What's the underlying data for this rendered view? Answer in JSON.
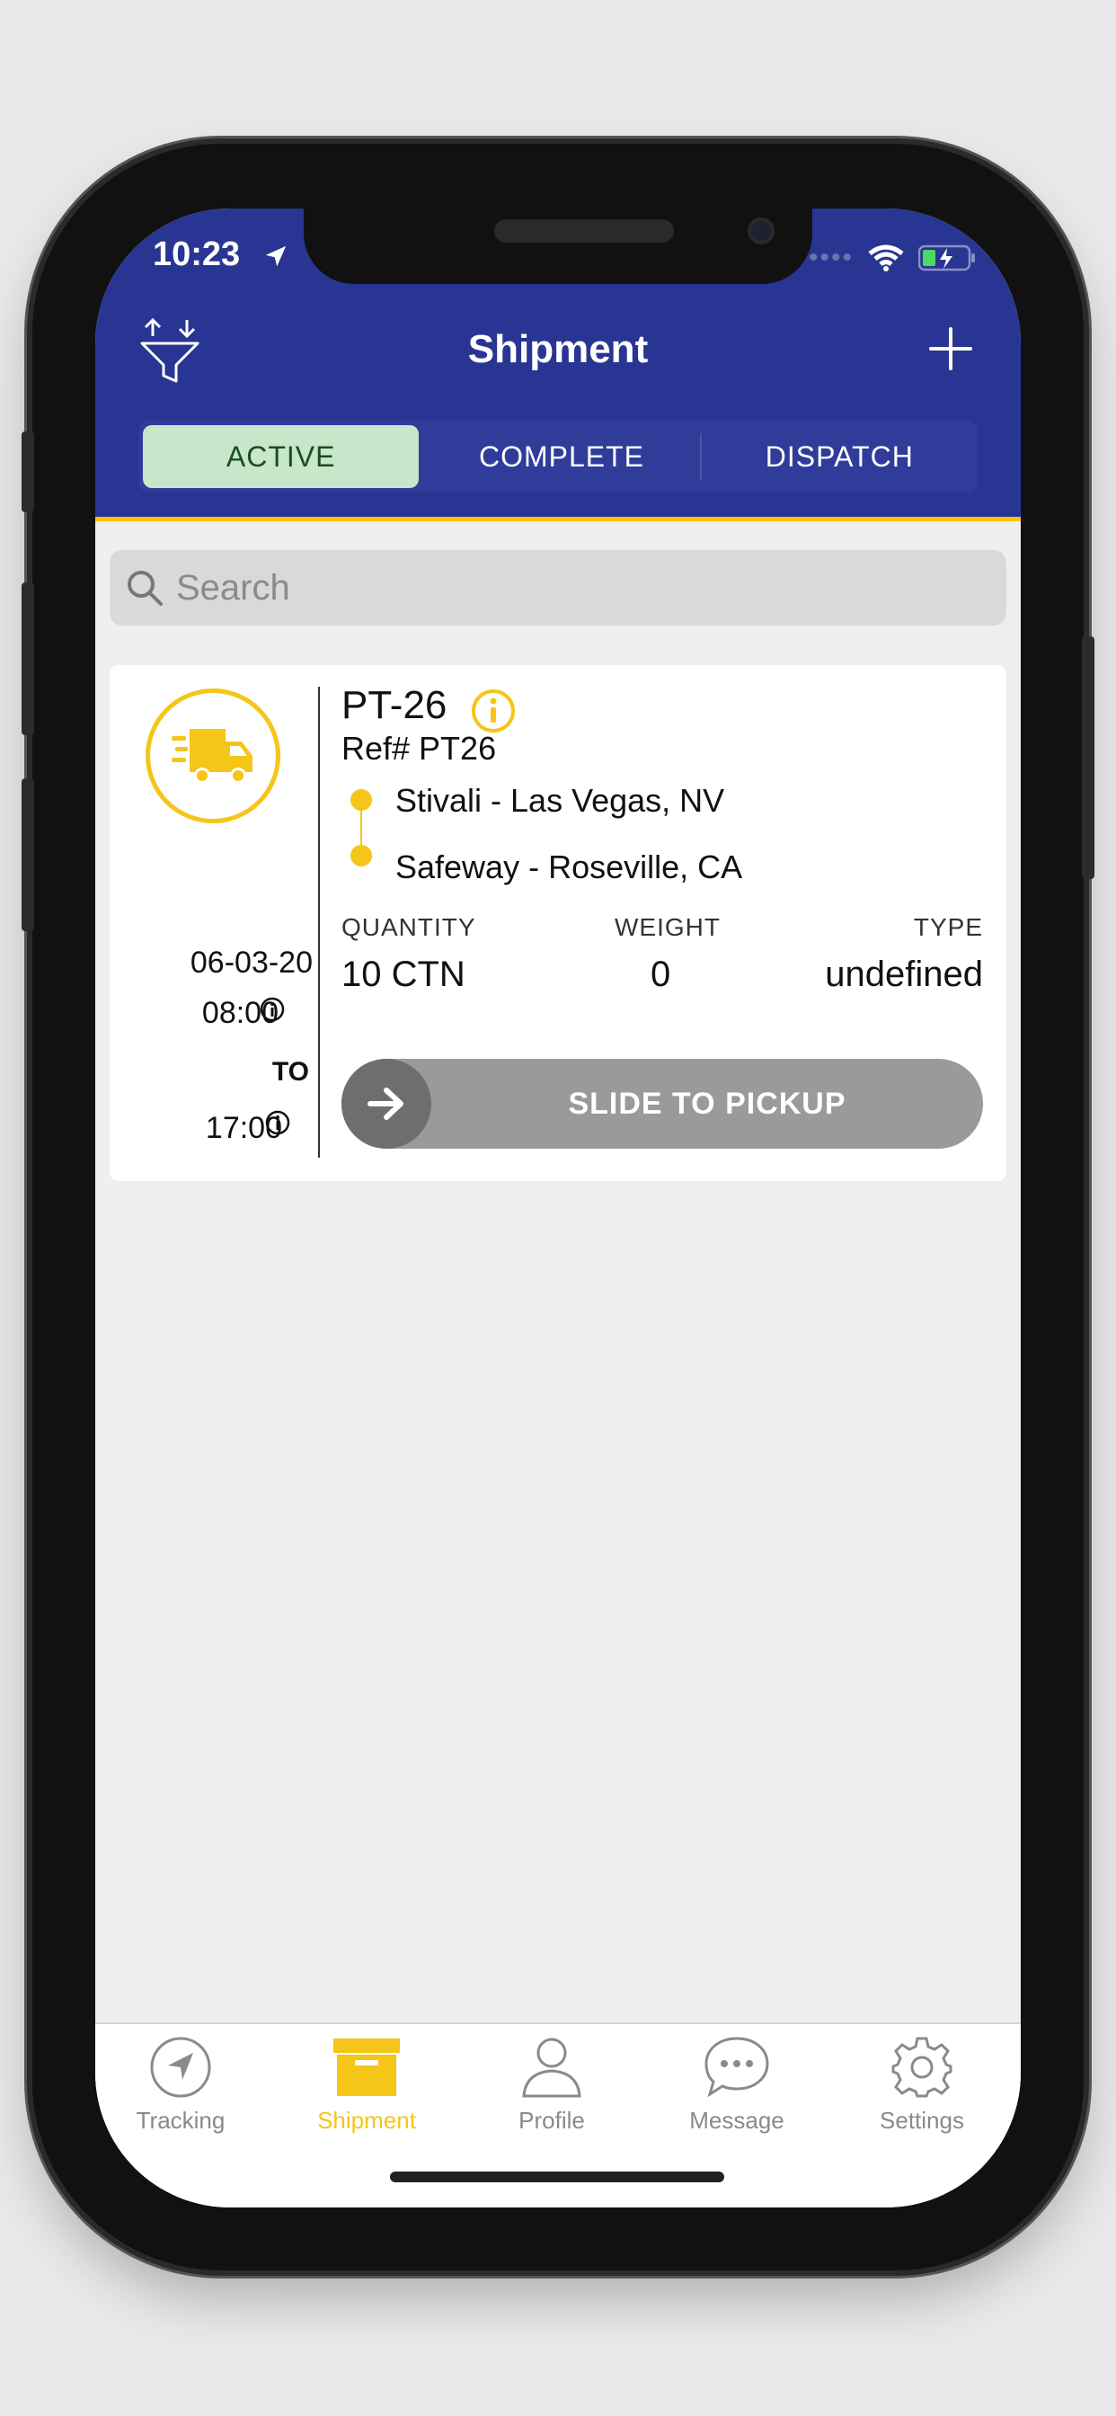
{
  "status": {
    "time": "10:23"
  },
  "header": {
    "title": "Shipment"
  },
  "tabs": [
    {
      "label": "ACTIVE",
      "active": true
    },
    {
      "label": "COMPLETE",
      "active": false
    },
    {
      "label": "DISPATCH",
      "active": false
    }
  ],
  "search": {
    "placeholder": "Search"
  },
  "shipment": {
    "id": "PT-26",
    "ref": "Ref# PT26",
    "date": "06-03-20",
    "start_time": "08:00",
    "to_label": "TO",
    "end_time": "17:00",
    "from": "Stivali - Las Vegas, NV",
    "to": "Safeway - Roseville, CA",
    "quantity_label": "QUANTITY",
    "quantity": "10 CTN",
    "weight_label": "WEIGHT",
    "weight": "0",
    "type_label": "TYPE",
    "type": "undefined",
    "slide_label": "SLIDE TO PICKUP"
  },
  "tabbar": [
    {
      "label": "Tracking",
      "icon": "navigation-arrow-icon",
      "active": false
    },
    {
      "label": "Shipment",
      "icon": "box-icon",
      "active": true
    },
    {
      "label": "Profile",
      "icon": "person-icon",
      "active": false
    },
    {
      "label": "Message",
      "icon": "chat-bubble-icon",
      "active": false
    },
    {
      "label": "Settings",
      "icon": "gear-icon",
      "active": false
    }
  ],
  "colors": {
    "header_bg": "#283593",
    "accent_yellow": "#f5c518",
    "active_tab_bg": "#c8e6c9"
  }
}
